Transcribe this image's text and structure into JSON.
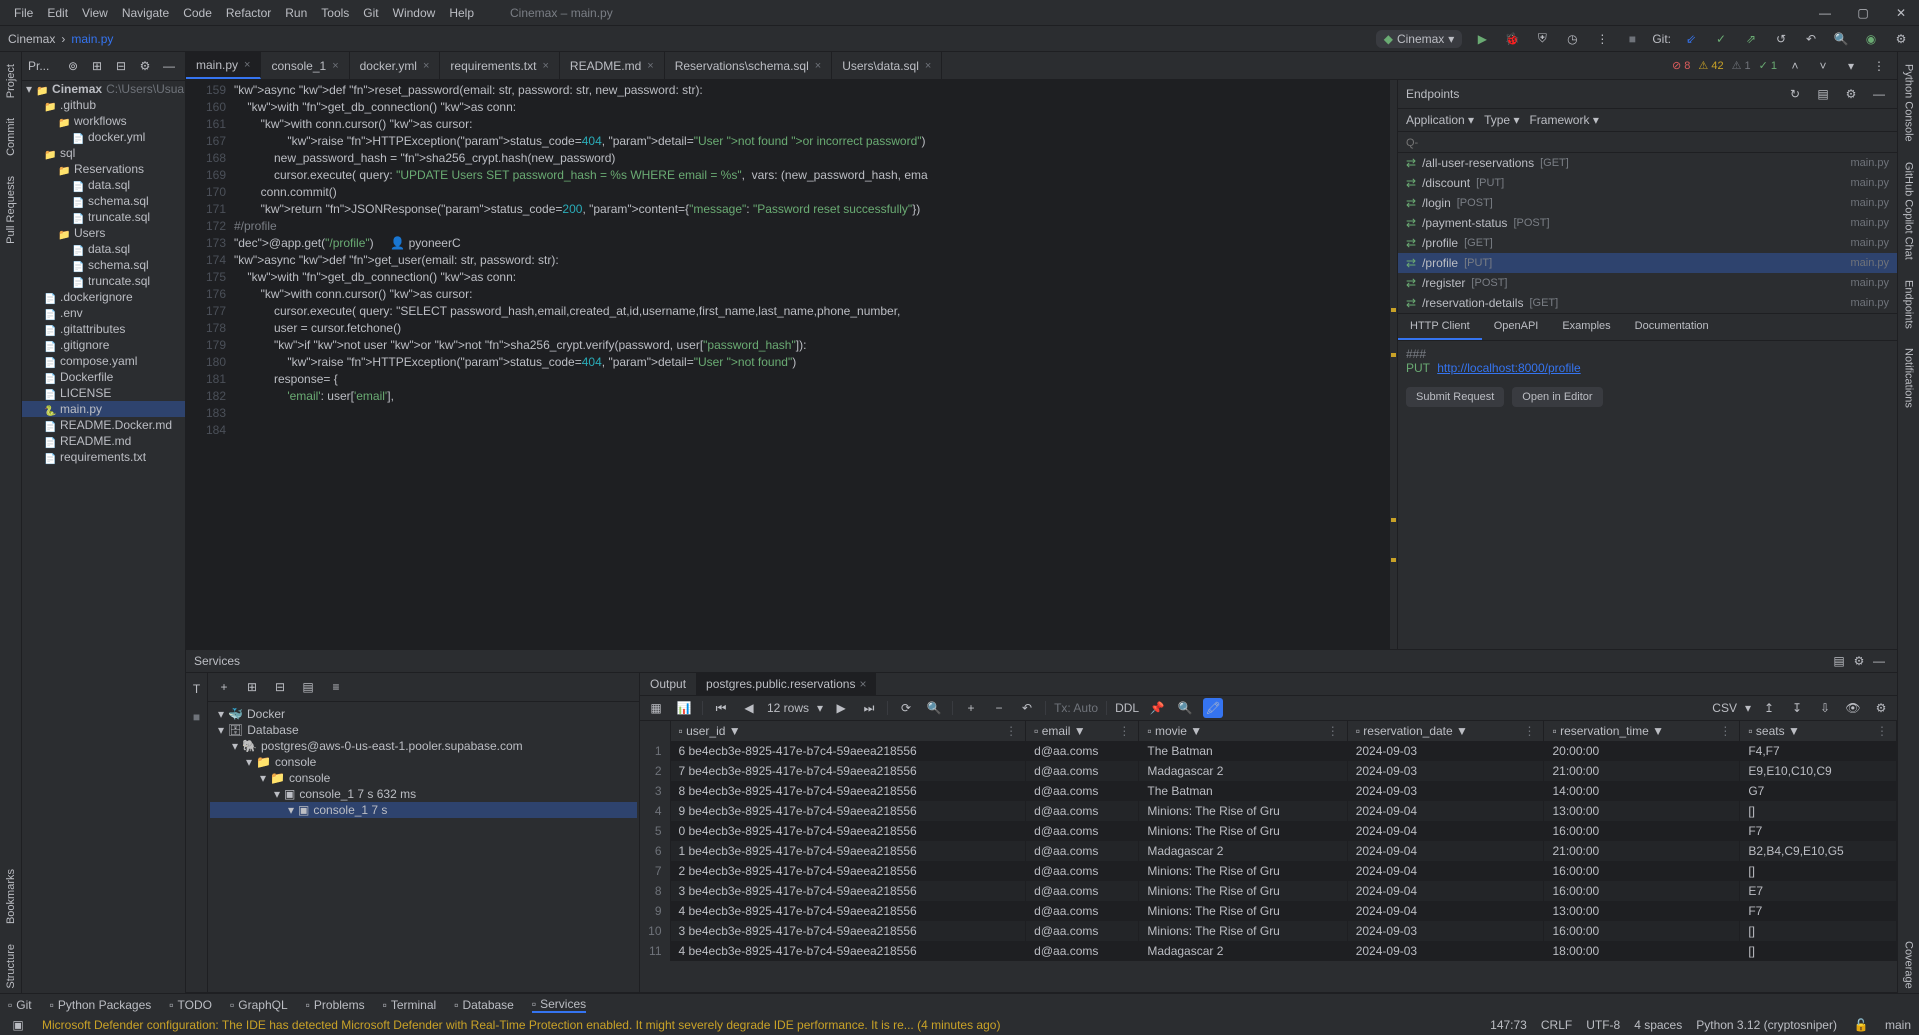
{
  "titlebar": {
    "menus": [
      "File",
      "Edit",
      "View",
      "Navigate",
      "Code",
      "Refactor",
      "Run",
      "Tools",
      "Git",
      "Window",
      "Help"
    ],
    "project_tab": "Cinemax – main.py"
  },
  "crumb": {
    "project": "Cinemax",
    "file": "main.py",
    "config": "Cinemax",
    "git_label": "Git:"
  },
  "project_panel": {
    "title": "Pr...",
    "root": "Cinemax",
    "root_path": "C:\\Users\\Usuari...",
    "nodes": [
      {
        "depth": 1,
        "icon": "folder",
        "label": ".github"
      },
      {
        "depth": 2,
        "icon": "folder",
        "label": "workflows"
      },
      {
        "depth": 3,
        "icon": "file",
        "label": "docker.yml"
      },
      {
        "depth": 1,
        "icon": "folder",
        "label": "sql"
      },
      {
        "depth": 2,
        "icon": "folder",
        "label": "Reservations"
      },
      {
        "depth": 3,
        "icon": "file",
        "label": "data.sql"
      },
      {
        "depth": 3,
        "icon": "file",
        "label": "schema.sql"
      },
      {
        "depth": 3,
        "icon": "file",
        "label": "truncate.sql"
      },
      {
        "depth": 2,
        "icon": "folder",
        "label": "Users"
      },
      {
        "depth": 3,
        "icon": "file",
        "label": "data.sql"
      },
      {
        "depth": 3,
        "icon": "file",
        "label": "schema.sql"
      },
      {
        "depth": 3,
        "icon": "file",
        "label": "truncate.sql"
      },
      {
        "depth": 1,
        "icon": "file",
        "label": ".dockerignore"
      },
      {
        "depth": 1,
        "icon": "file",
        "label": ".env"
      },
      {
        "depth": 1,
        "icon": "file",
        "label": ".gitattributes"
      },
      {
        "depth": 1,
        "icon": "file",
        "label": ".gitignore"
      },
      {
        "depth": 1,
        "icon": "file",
        "label": "compose.yaml"
      },
      {
        "depth": 1,
        "icon": "file",
        "label": "Dockerfile"
      },
      {
        "depth": 1,
        "icon": "file",
        "label": "LICENSE"
      },
      {
        "depth": 1,
        "icon": "py",
        "label": "main.py",
        "sel": true
      },
      {
        "depth": 1,
        "icon": "file",
        "label": "README.Docker.md"
      },
      {
        "depth": 1,
        "icon": "file",
        "label": "README.md"
      },
      {
        "depth": 1,
        "icon": "file",
        "label": "requirements.txt"
      }
    ]
  },
  "tabs": [
    {
      "label": "main.py",
      "active": true
    },
    {
      "label": "console_1"
    },
    {
      "label": "docker.yml"
    },
    {
      "label": "requirements.txt"
    },
    {
      "label": "README.md"
    },
    {
      "label": "Reservations\\schema.sql"
    },
    {
      "label": "Users\\data.sql"
    }
  ],
  "problems": {
    "errors": "8",
    "warnings": "42",
    "weak": "1",
    "typo": "1"
  },
  "gutter_start": 159,
  "code_lines": [
    "async def reset_password(email: str, password: str, new_password: str):",
    "    with get_db_connection() as conn:",
    "        with conn.cursor() as cursor:",
    "",
    "                raise HTTPException(status_code=404, detail=\"User not found or incorrect password\")",
    "",
    "            new_password_hash = sha256_crypt.hash(new_password)",
    "            cursor.execute( query: \"UPDATE Users SET password_hash = %s WHERE email = %s\",  vars: (new_password_hash, ema",
    "",
    "        conn.commit()",
    "        return JSONResponse(status_code=200, content={\"message\": \"Password reset successfully\"})",
    "",
    "#/profile",
    "@app.get(\"/profile\")     👤 pyoneerC",
    "async def get_user(email: str, password: str):",
    "    with get_db_connection() as conn:",
    "        with conn.cursor() as cursor:",
    "            cursor.execute( query: \"SELECT password_hash,email,created_at,id,username,first_name,last_name,phone_number,",
    "            user = cursor.fetchone()",
    "            if not user or not sha256_crypt.verify(password, user[\"password_hash\"]):",
    "                raise HTTPException(status_code=404, detail=\"User not found\")",
    "            response= {",
    "                'email': user['email'],"
  ],
  "gutter_numbers": [
    "159",
    "160",
    "161",
    "167",
    "168",
    "169",
    "170",
    "171",
    "172",
    "173",
    "174",
    "175",
    "176",
    "177",
    "178",
    "179",
    "180",
    "181",
    "182",
    "183",
    "184"
  ],
  "endpoints": {
    "title": "Endpoints",
    "filters": [
      "Application",
      "Type",
      "Framework"
    ],
    "search_ph": "Q-",
    "items": [
      {
        "path": "/all-user-reservations",
        "meth": "[GET]",
        "file": "main.py"
      },
      {
        "path": "/discount",
        "meth": "[PUT]",
        "file": "main.py"
      },
      {
        "path": "/login",
        "meth": "[POST]",
        "file": "main.py"
      },
      {
        "path": "/payment-status",
        "meth": "[POST]",
        "file": "main.py"
      },
      {
        "path": "/profile",
        "meth": "[GET]",
        "file": "main.py"
      },
      {
        "path": "/profile",
        "meth": "[PUT]",
        "file": "main.py",
        "sel": true
      },
      {
        "path": "/register",
        "meth": "[POST]",
        "file": "main.py"
      },
      {
        "path": "/reservation-details",
        "meth": "[GET]",
        "file": "main.py"
      }
    ],
    "detail_tabs": [
      "HTTP Client",
      "OpenAPI",
      "Examples",
      "Documentation"
    ],
    "req_comment": "###",
    "req_method": "PUT",
    "req_url": "http://localhost:8000/profile",
    "submit": "Submit Request",
    "open": "Open in Editor"
  },
  "services": {
    "title": "Services",
    "tree": [
      {
        "depth": 0,
        "label": "Docker",
        "icon": "🐳"
      },
      {
        "depth": 0,
        "label": "Database",
        "icon": "🗄"
      },
      {
        "depth": 1,
        "label": "postgres@aws-0-us-east-1.pooler.supabase.com",
        "icon": "🐘"
      },
      {
        "depth": 2,
        "label": "console",
        "icon": "📁"
      },
      {
        "depth": 3,
        "label": "console",
        "icon": "📁"
      },
      {
        "depth": 4,
        "label": "console_1  7 s 632 ms",
        "icon": "▣"
      },
      {
        "depth": 5,
        "label": "console_1  7 s",
        "icon": "▣",
        "sel": true
      }
    ],
    "tabs": [
      {
        "label": "Output"
      },
      {
        "label": "postgres.public.reservations",
        "active": true,
        "closable": true
      }
    ],
    "toolbar_rows": "12 rows",
    "toolbar_tx": "Tx: Auto",
    "toolbar_ddl": "DDL",
    "toolbar_csv": "CSV",
    "columns": [
      "user_id",
      "email",
      "movie",
      "reservation_date",
      "reservation_time",
      "seats"
    ],
    "rows": [
      {
        "n": "1",
        "c": [
          "6  be4ecb3e-8925-417e-b7c4-59aeea218556",
          "d@aa.coms",
          "The Batman",
          "2024-09-03",
          "20:00:00",
          "F4,F7"
        ]
      },
      {
        "n": "2",
        "c": [
          "7  be4ecb3e-8925-417e-b7c4-59aeea218556",
          "d@aa.coms",
          "Madagascar 2",
          "2024-09-03",
          "21:00:00",
          "E9,E10,C10,C9"
        ]
      },
      {
        "n": "3",
        "c": [
          "8  be4ecb3e-8925-417e-b7c4-59aeea218556",
          "d@aa.coms",
          "The Batman",
          "2024-09-03",
          "14:00:00",
          "G7"
        ]
      },
      {
        "n": "4",
        "c": [
          "9  be4ecb3e-8925-417e-b7c4-59aeea218556",
          "d@aa.coms",
          "Minions: The Rise of Gru",
          "2024-09-04",
          "13:00:00",
          "[]"
        ]
      },
      {
        "n": "5",
        "c": [
          "0  be4ecb3e-8925-417e-b7c4-59aeea218556",
          "d@aa.coms",
          "Minions: The Rise of Gru",
          "2024-09-04",
          "16:00:00",
          "F7"
        ]
      },
      {
        "n": "6",
        "c": [
          "1  be4ecb3e-8925-417e-b7c4-59aeea218556",
          "d@aa.coms",
          "Madagascar 2",
          "2024-09-04",
          "21:00:00",
          "B2,B4,C9,E10,G5"
        ]
      },
      {
        "n": "7",
        "c": [
          "2  be4ecb3e-8925-417e-b7c4-59aeea218556",
          "d@aa.coms",
          "Minions: The Rise of Gru",
          "2024-09-04",
          "16:00:00",
          "[]"
        ]
      },
      {
        "n": "8",
        "c": [
          "3  be4ecb3e-8925-417e-b7c4-59aeea218556",
          "d@aa.coms",
          "Minions: The Rise of Gru",
          "2024-09-04",
          "16:00:00",
          "E7"
        ]
      },
      {
        "n": "9",
        "c": [
          "4  be4ecb3e-8925-417e-b7c4-59aeea218556",
          "d@aa.coms",
          "Minions: The Rise of Gru",
          "2024-09-04",
          "13:00:00",
          "F7"
        ]
      },
      {
        "n": "10",
        "c": [
          "3  be4ecb3e-8925-417e-b7c4-59aeea218556",
          "d@aa.coms",
          "Minions: The Rise of Gru",
          "2024-09-03",
          "16:00:00",
          "[]"
        ]
      },
      {
        "n": "11",
        "c": [
          "4  be4ecb3e-8925-417e-b7c4-59aeea218556",
          "d@aa.coms",
          "Madagascar 2",
          "2024-09-03",
          "18:00:00",
          "[]"
        ]
      }
    ]
  },
  "bottom_bar": [
    "Git",
    "Python Packages",
    "TODO",
    "GraphQL",
    "Problems",
    "Terminal",
    "Database",
    "Services"
  ],
  "bottom_bar_active": 7,
  "left_rail": [
    "Project",
    "Commit",
    "Pull Requests"
  ],
  "left_rail2": [
    "Bookmarks",
    "Structure"
  ],
  "right_rail": [
    "Python Console",
    "GitHub Copilot Chat",
    "Endpoints",
    "Notifications"
  ],
  "right_rail2": [
    "Coverage"
  ],
  "status": {
    "msg": "Microsoft Defender configuration: The IDE has detected Microsoft Defender with Real-Time Protection enabled. It might severely degrade IDE performance. It is re... (4 minutes ago)",
    "pos": "147:73",
    "le": "CRLF",
    "enc": "UTF-8",
    "indent": "4 spaces",
    "py": "Python 3.12 (cryptosniper)",
    "branch": "main"
  }
}
